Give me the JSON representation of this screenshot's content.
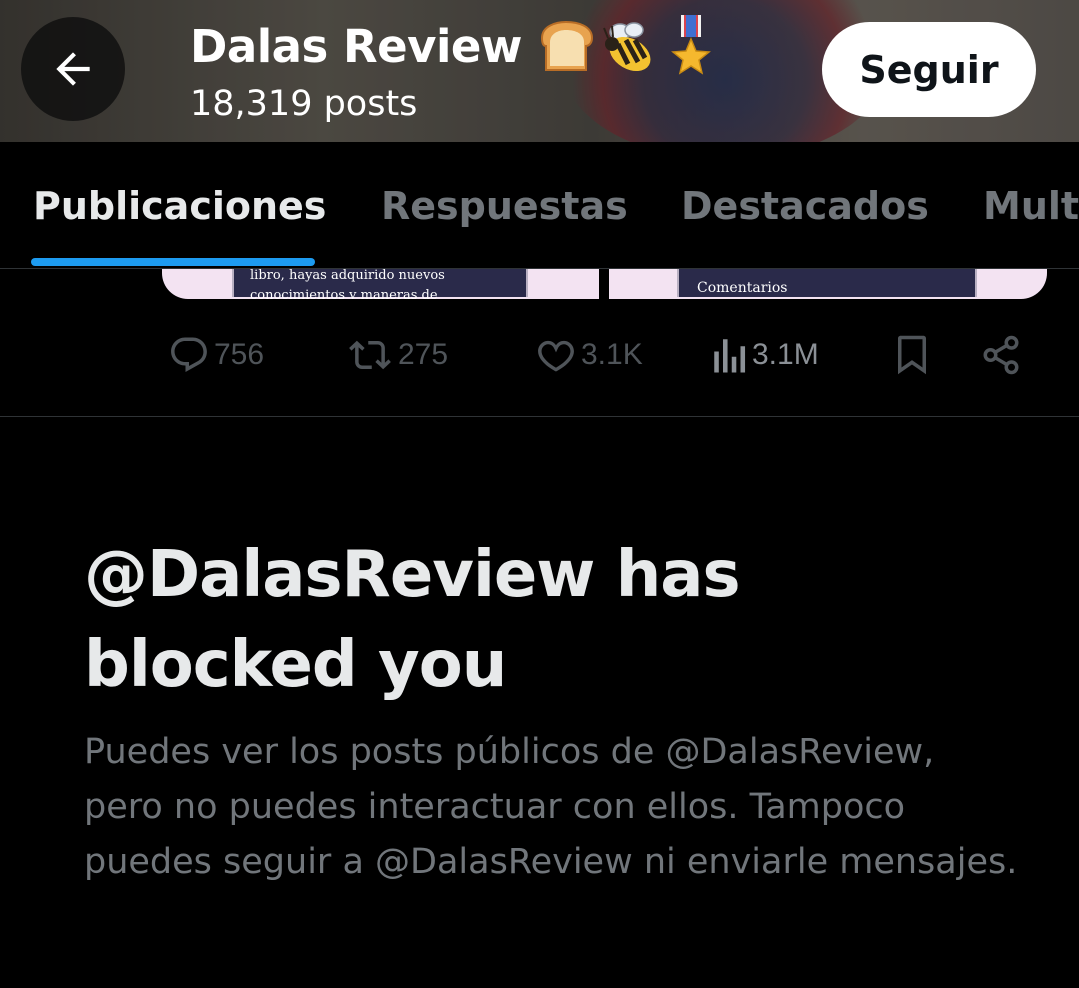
{
  "header": {
    "profile_name": "Dalas Review",
    "name_emojis": [
      "bread-emoji",
      "bee-emoji",
      "military-medal-emoji"
    ],
    "post_count": "18,319 posts",
    "follow_label": "Seguir"
  },
  "tabs": [
    {
      "label": "Publicaciones",
      "active": true
    },
    {
      "label": "Respuestas",
      "active": false
    },
    {
      "label": "Destacados",
      "active": false
    },
    {
      "label": "Multi",
      "active": false
    }
  ],
  "post": {
    "media_left_text": [
      "libro, hayas adquirido nuevos",
      "conocimientos y maneras de"
    ],
    "media_right_text": "Comentarios",
    "actions": {
      "replies": "756",
      "reposts": "275",
      "likes": "3.1K",
      "views": "3.1M"
    }
  },
  "blocked": {
    "title_line1": "@DalasReview has",
    "title_line2": "blocked you",
    "description": "Puedes ver los posts públicos de @DalasReview, pero no puedes interactuar con ellos. Tampoco puedes seguir a @DalasReview ni enviarle mensajes."
  },
  "colors": {
    "accent": "#1d9bf0",
    "background": "#000000",
    "primary_text": "#e7e9ea",
    "secondary_text": "#71767b"
  }
}
